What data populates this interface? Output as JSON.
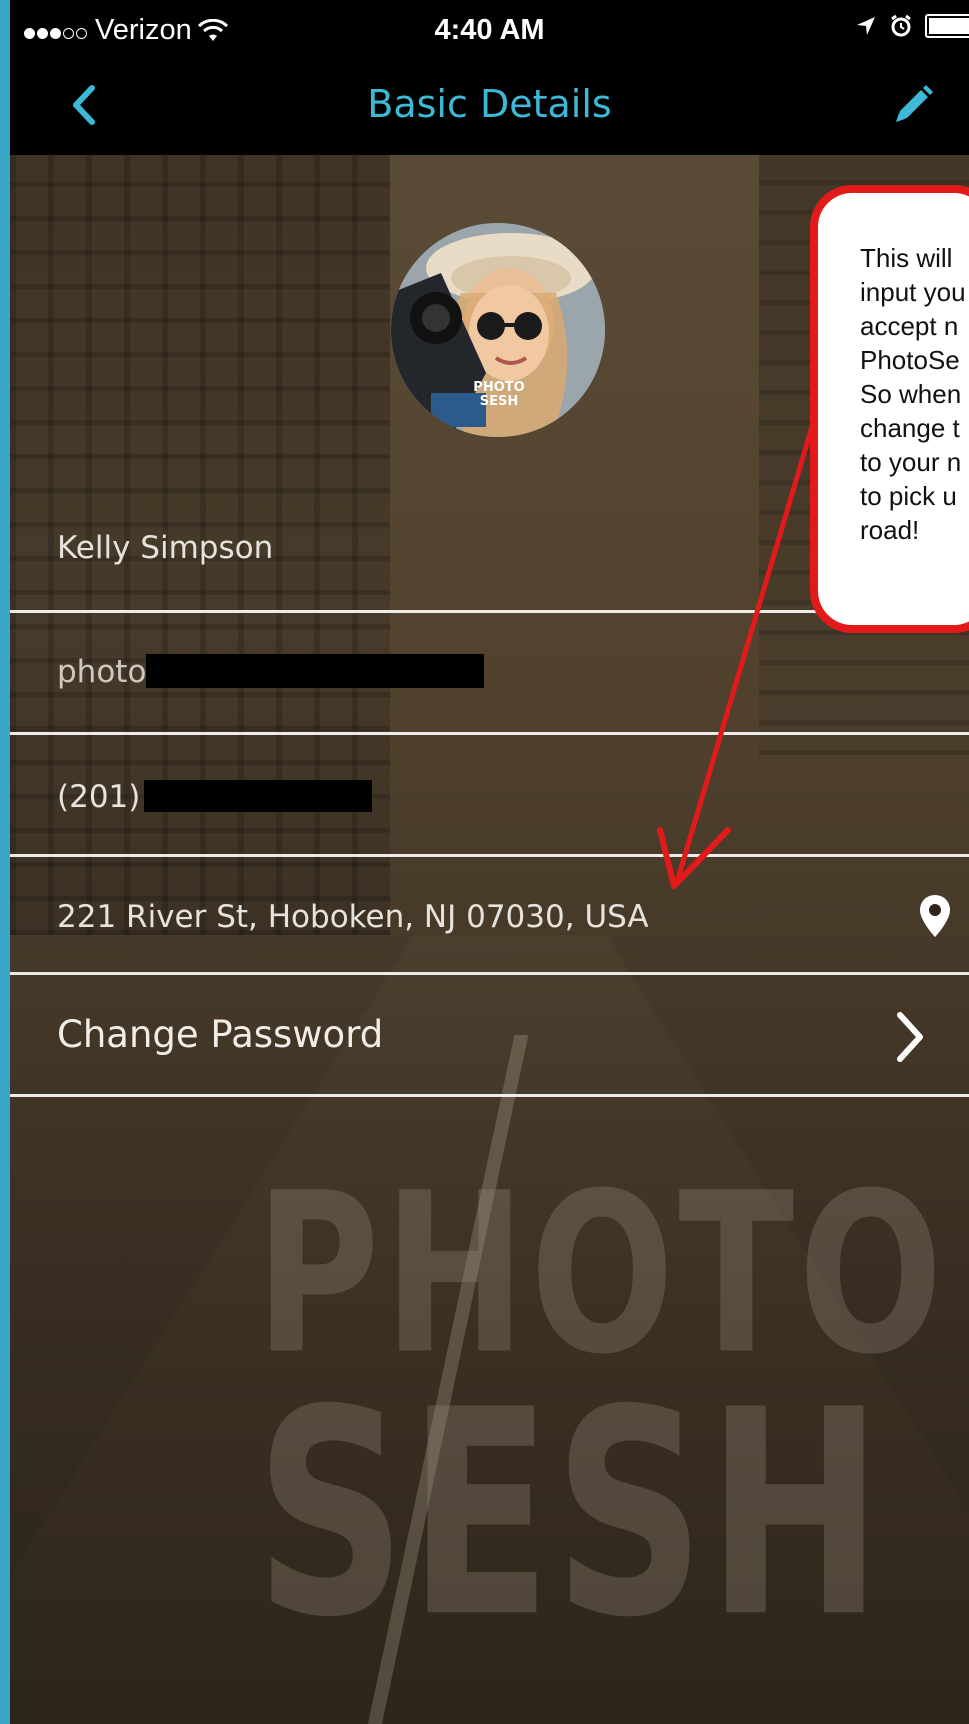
{
  "status_bar": {
    "carrier": "Verizon",
    "time": "4:40 AM",
    "signal_filled": 3,
    "signal_total": 5,
    "battery_level": 1.0
  },
  "nav": {
    "title": "Basic Details",
    "back_icon": "chevron-left-icon",
    "edit_icon": "pencil-icon",
    "accent_color": "#3db9d6"
  },
  "profile": {
    "avatar_badge": "PHOTO SESH"
  },
  "fields": {
    "name": "Kelly Simpson",
    "email_prefix": "photo",
    "phone_prefix": "(201)",
    "address": "221 River St, Hoboken, NJ 07030, USA",
    "change_password": "Change Password"
  },
  "icons": {
    "location": "map-pin-icon",
    "chevron": "chevron-right-icon"
  },
  "callout": {
    "lines": [
      "This will",
      "input you",
      "accept n",
      "PhotoSe",
      "So when",
      "change t",
      "to your n",
      "to pick u",
      "road!"
    ],
    "border_color": "#e21a1a"
  },
  "watermark": {
    "line1": "PHOTO",
    "line2": "SESH"
  }
}
